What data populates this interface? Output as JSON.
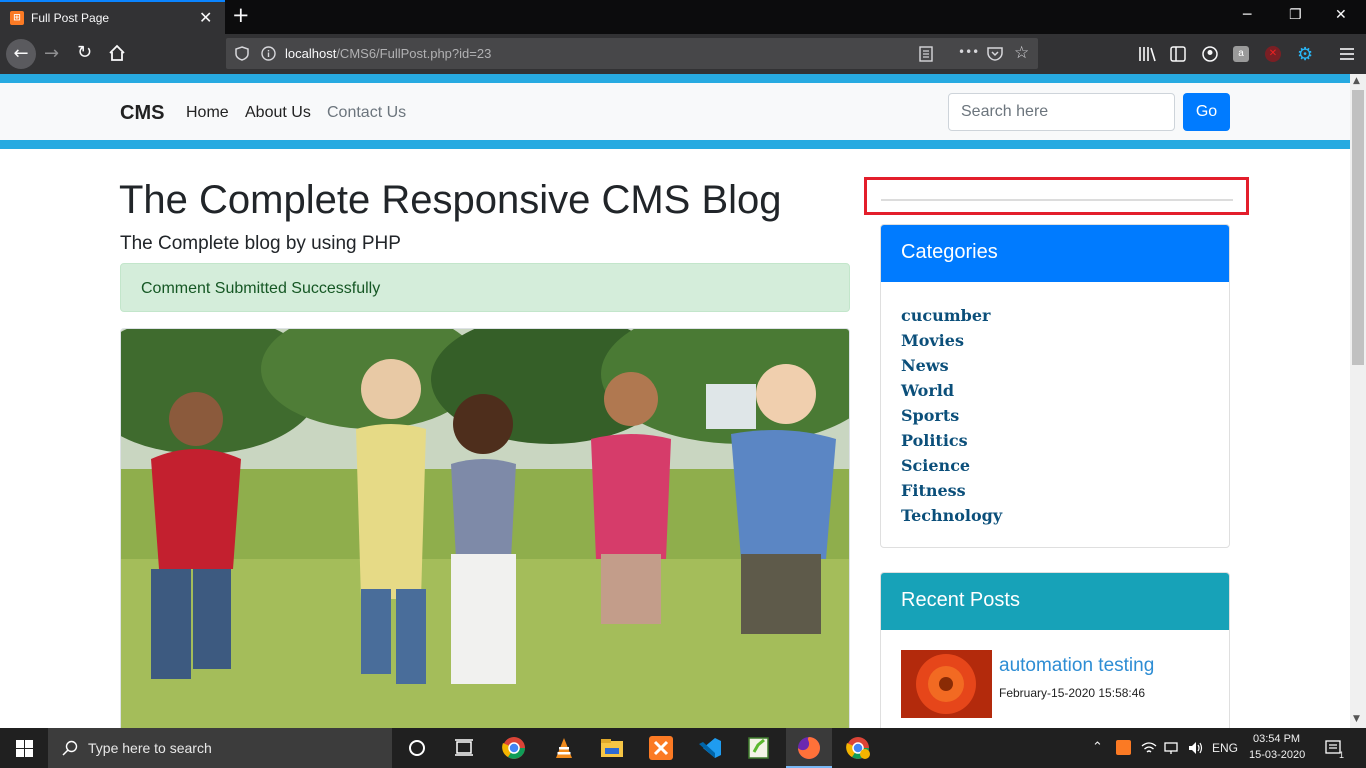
{
  "browser": {
    "tab_title": "Full Post Page",
    "tab_favicon_glyph": "⊞",
    "close_glyph": "✕",
    "new_tab_glyph": "+",
    "minimize_glyph": "─",
    "restore_glyph": "❐",
    "window_close_glyph": "✕",
    "url_host": "localhost",
    "url_path": "/CMS6/FullPost.php?id=23",
    "more_glyph": "•••",
    "accent_color": "#27aae1"
  },
  "site": {
    "brand": "CMS",
    "nav": {
      "home": "Home",
      "about": "About Us",
      "contact": "Contact Us"
    },
    "search": {
      "placeholder": "Search here",
      "button": "Go"
    }
  },
  "main": {
    "title": "The Complete Responsive CMS Blog",
    "subtitle": "The Complete blog by using PHP",
    "alert": "Comment Submitted Successfully"
  },
  "sidebar": {
    "categories_title": "Categories",
    "categories": [
      "cucumber",
      "Movies",
      "News",
      "World",
      "Sports",
      "Politics",
      "Science",
      "Fitness",
      "Technology"
    ],
    "recent_title": "Recent Posts",
    "recent_posts": [
      {
        "title": "automation testing",
        "date": "February-15-2020 15:58:46"
      }
    ]
  },
  "taskbar": {
    "search_placeholder": "Type here to search",
    "language": "ENG",
    "time": "03:54 PM",
    "date": "15-03-2020",
    "notification_count": "1"
  }
}
